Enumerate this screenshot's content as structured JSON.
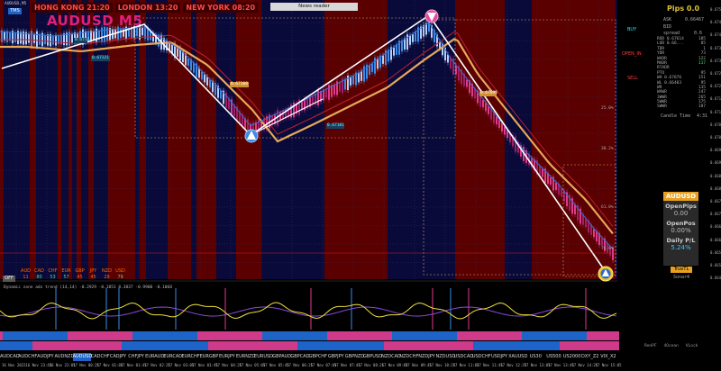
{
  "window": {
    "mini_title": "AUDUSD,M5",
    "btn": "TMS",
    "symbol_title": "AUDUSD M5",
    "news_label": "News reader"
  },
  "sessions": [
    {
      "label": "HONG KONG 21:20"
    },
    {
      "label": "LONDON 13:20"
    },
    {
      "label": "NEW YORK 08:20"
    }
  ],
  "chart_labels": {
    "lvl1": "0.67221",
    "lvl2": "0.67174",
    "lvl3": "0.67108",
    "lvl4": "0.67095",
    "lvl5": "0.67101",
    "pct1": "25.0%",
    "pct2": "38.2%",
    "pct3": "61.8%",
    "pct4": "78.6%"
  },
  "right_panel": {
    "pips": "Pips 0.0",
    "ask_label": "ASK",
    "ask_val": "0.66467",
    "bid_label": "BID",
    "spread_label": "spread",
    "spread_val": "0.6",
    "rows": [
      {
        "k": "ROD 0.67614",
        "v": "185"
      },
      {
        "k": "LOD 0.66...",
        "v": "85"
      },
      {
        "k": "TDR",
        "v": "1"
      },
      {
        "k": "YDR",
        "v": "73"
      },
      {
        "k": "WADR",
        "v": "122"
      },
      {
        "k": "MADR",
        "v": "117"
      },
      {
        "k": "RTADR",
        "v": ""
      },
      {
        "k": "PTO",
        "v": "95"
      },
      {
        "k": "WH 0.67876",
        "v": "151"
      },
      {
        "k": "WL 0.66403",
        "v": "95"
      },
      {
        "k": "WR",
        "v": "135"
      },
      {
        "k": "WAWR",
        "v": "247"
      },
      {
        "k": "3WWR",
        "v": "265"
      },
      {
        "k": "5WWR",
        "v": "175"
      },
      {
        "k": "SWWR",
        "v": "187"
      }
    ],
    "buy": "BUY",
    "open_in": "OPEN_IN",
    "sell": "SELL",
    "candle_time_label": "Candle Time",
    "candle_time_val": "4:31"
  },
  "info_box": {
    "symbol": "AUDUSD",
    "open_pips_label": "OpenPips",
    "open_pips_val": "0.00",
    "open_pos_label": "OpenPos",
    "open_pos_val": "0.00%",
    "daily_pl_label": "Daily P/L",
    "daily_pl_val": "5.24%",
    "true_tl": "TrueTL",
    "sonar": "Sonar4"
  },
  "strength": {
    "currencies": [
      "AUD",
      "CAD",
      "CHF",
      "EUR",
      "GBP",
      "JPY",
      "NZD",
      "USD"
    ],
    "values": [
      "11",
      "80",
      "53",
      "57",
      "45",
      "45",
      "29",
      "79"
    ],
    "colors": [
      "#ff6a00",
      "#3de86b",
      "#3de86b",
      "#3de86b",
      "#ff6a00",
      "#ff6a00",
      "#ff6a00",
      "#3de86b"
    ],
    "off_btn": "OFF"
  },
  "indicator": {
    "label": "Dynamic zone adx trend (14,14) -0.2929 -0.1851 0.3837 -0.9900 -0.1068"
  },
  "symbols": [
    "AUDCAD",
    "AUDCHF",
    "AUDJPY",
    "AUDNZD",
    "AUDUSD",
    "CADCHF",
    "CADJPY",
    "CHFJPY",
    "EURAUD",
    "EURCAD",
    "EURCHF",
    "EURGBP",
    "EURJPY",
    "EURNZD",
    "EURUSD",
    "GBPAUD",
    "GBPCAD",
    "GBPCHF",
    "GBPJPY",
    "GBPNZD",
    "GBPUSD",
    "NZDCAD",
    "NZDCHF",
    "NZDJPY",
    "NZDUSD",
    "USDCAD",
    "USDCHF",
    "USDJPY",
    "XAUUSD",
    "US30",
    "US500",
    "US2000",
    "DXY_Z2",
    "VIX_X2"
  ],
  "active_symbol": "AUDUSD",
  "times": [
    "16 Nov 2022",
    "16 Nov 23:45",
    "16 Nov 22:05",
    "17 Nov 00:25",
    "17 Nov 01:05",
    "17 Nov 01:45",
    "17 Nov 02:25",
    "17 Nov 03:05",
    "17 Nov 03:45",
    "17 Nov 04:25",
    "17 Nov 05:05",
    "17 Nov 05:45",
    "17 Nov 06:25",
    "17 Nov 07:05",
    "17 Nov 07:45",
    "17 Nov 08:25",
    "17 Nov 09:05",
    "17 Nov 09:45",
    "17 Nov 10:25",
    "17 Nov 11:05",
    "17 Nov 11:45",
    "17 Nov 12:25",
    "17 Nov 13:05",
    "17 Nov 13:45",
    "17 Nov 14:25",
    "17 Nov 15:05"
  ],
  "prices": [
    "0.67500",
    "0.67450",
    "0.67400",
    "0.67350",
    "0.67300",
    "0.67250",
    "0.67200",
    "0.67150",
    "0.67100",
    "0.67050",
    "0.67000",
    "0.66950",
    "0.66900",
    "0.66850",
    "0.66800",
    "0.66750",
    "0.66700",
    "0.66650",
    "0.66600",
    "0.66550",
    "0.66500",
    "0.66450"
  ],
  "bottom_right": [
    "RenPF",
    "4Ocean",
    "VLock"
  ]
}
